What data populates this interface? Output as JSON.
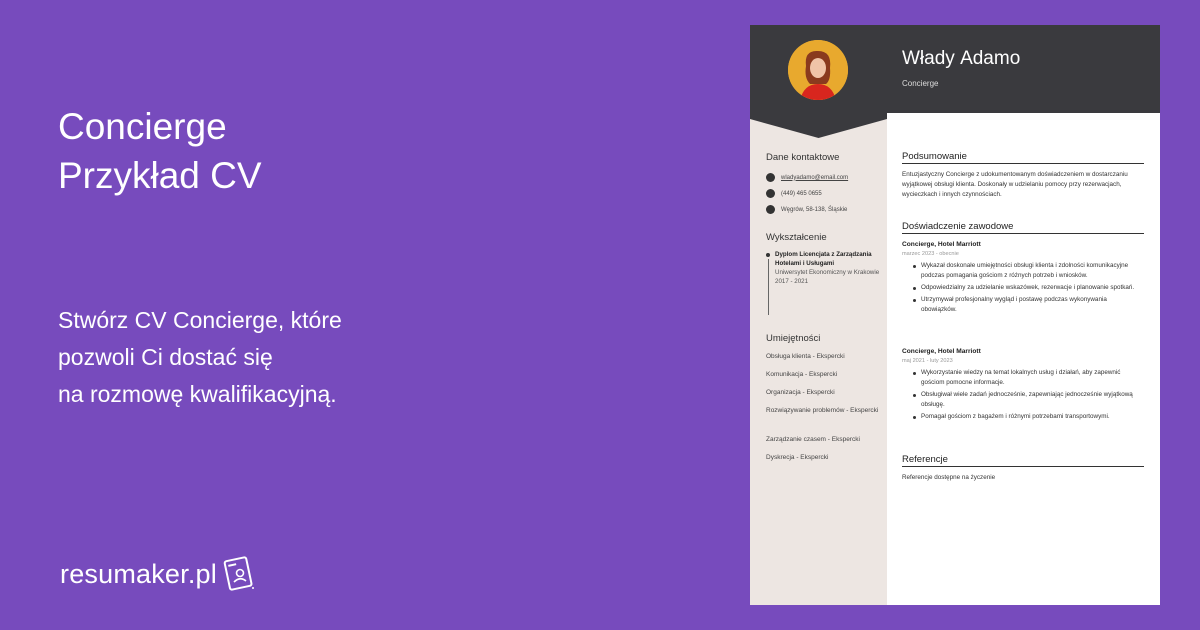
{
  "headline": {
    "line1": "Concierge",
    "line2": "Przykład CV"
  },
  "subline": {
    "line1": "Stwórz CV Concierge, które",
    "line2": "pozwoli Ci dostać się",
    "line3": "na rozmowę kwalifikacyjną."
  },
  "brand": {
    "name": "resumaker.pl"
  },
  "colors": {
    "background": "#774bbd",
    "cv_header": "#3a3a3e",
    "cv_sidebar": "#ede6e2",
    "photo_bg": "#e8a92e"
  },
  "cv": {
    "name": "Władу Adamo",
    "role": "Concierge",
    "contact_title": "Dane kontaktowe",
    "contacts": [
      {
        "icon": "email-icon",
        "text": "wladyadamo@email.com"
      },
      {
        "icon": "phone-icon",
        "text": "(449) 465 0655"
      },
      {
        "icon": "location-icon",
        "text": "Węgrów, 58-138, Śląskie"
      }
    ],
    "education_title": "Wykształcenie",
    "education": {
      "degree": "Dyplom Licencjata z Zarządzania Hotelami i Usługami",
      "school": "Uniwersytet Ekonomiczny w Krakowie",
      "years": "2017 - 2021"
    },
    "skills_title": "Umiejętności",
    "skills": [
      "Obsługa klienta - Ekspercki",
      "Komunikacja - Ekspercki",
      "Organizacja - Ekspercki",
      "Rozwiązywanie problemów - Ekspercki",
      "Zarządzanie czasem - Ekspercki",
      "Dyskrecja - Ekspercki"
    ],
    "summary_title": "Podsumowanie",
    "summary": "Entuzjastyczny Concierge z udokumentowanym doświadczeniem w dostarczaniu wyjątkowej obsługi klienta. Doskonały w udzielaniu pomocy przy rezerwacjach, wycieczkach i innych czynnościach.",
    "experience_title": "Doświadczenie zawodowe",
    "jobs": [
      {
        "title": "Concierge, Hotel Marriott",
        "date": "marzec 2023 - obecnie",
        "bullets": [
          "Wykazał doskonałe umiejętności obsługi klienta i zdolności komunikacyjne podczas pomagania gościom z różnych potrzeb i wniosków.",
          "Odpowiedzialny za udzielanie wskazówek, rezerwacje i planowanie spotkań.",
          "Utrzymywał profesjonalny wygląd i postawę podczas wykonywania obowiązków."
        ]
      },
      {
        "title": "Concierge, Hotel Marriott",
        "date": "maj 2021 - luty 2023",
        "bullets": [
          "Wykorzystanie wiedzy na temat lokalnych usług i działań, aby zapewnić gościom pomocne informacje.",
          "Obsługiwał wiele zadań jednocześnie, zapewniając jednocześnie wyjątkową obsługę.",
          "Pomagał gościom z bagażem i różnymi potrzebami transportowymi."
        ]
      }
    ],
    "references_title": "Referencje",
    "references": "Referencje dostępne na życzenie"
  }
}
